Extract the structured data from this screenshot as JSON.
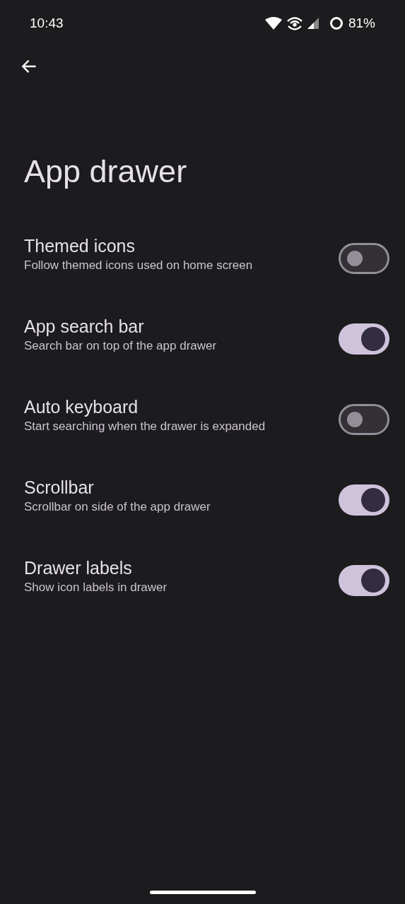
{
  "status_bar": {
    "time": "10:43",
    "battery": "81%"
  },
  "title": "App drawer",
  "settings": [
    {
      "title": "Themed icons",
      "subtitle": "Follow themed icons used on home screen",
      "on": false
    },
    {
      "title": "App search bar",
      "subtitle": "Search bar on top of the app drawer",
      "on": true
    },
    {
      "title": "Auto keyboard",
      "subtitle": "Start searching when the drawer is expanded",
      "on": false
    },
    {
      "title": "Scrollbar",
      "subtitle": "Scrollbar on side of the app drawer",
      "on": true
    },
    {
      "title": "Drawer labels",
      "subtitle": "Show icon labels in drawer",
      "on": true
    }
  ]
}
